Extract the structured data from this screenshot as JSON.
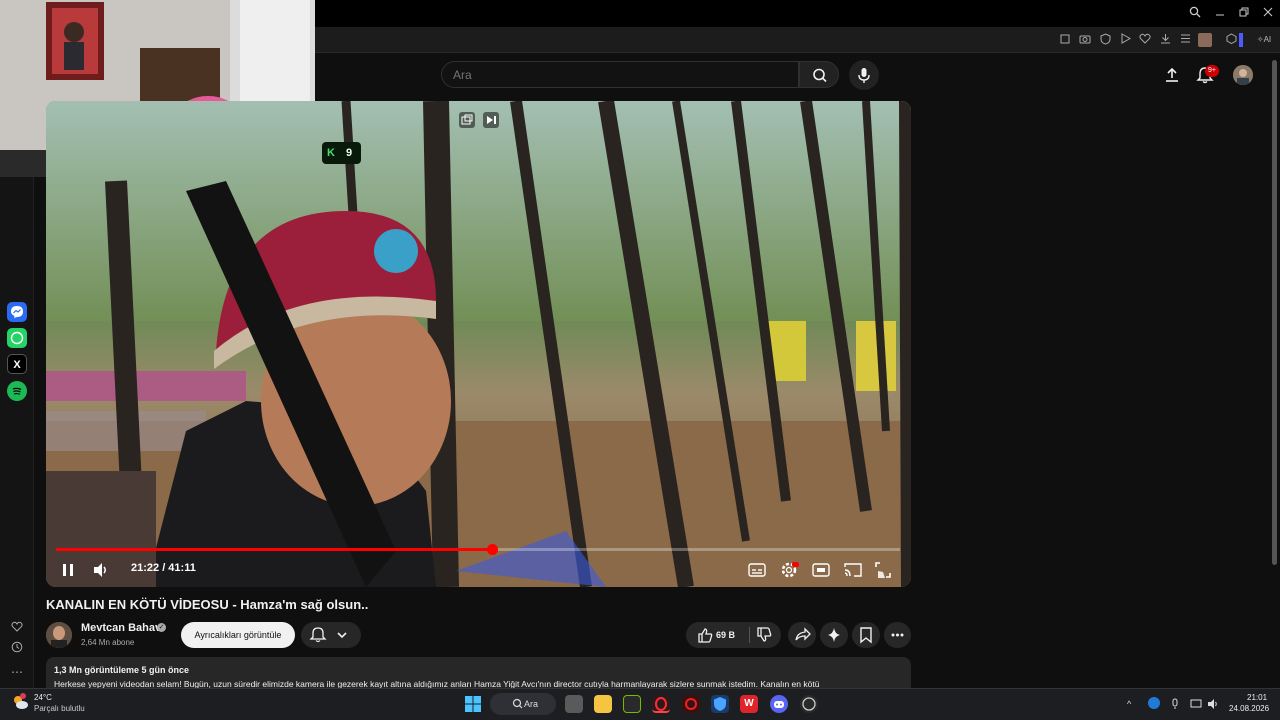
{
  "search": {
    "placeholder": "Ara"
  },
  "header": {
    "notif_badge": "9+"
  },
  "overlay": {
    "counter": "9"
  },
  "player": {
    "time": "21:22 / 41:11",
    "progress": 0.5171
  },
  "video": {
    "title": "KANALIN EN KÖTÜ VİDEOSU - Hamza'm sağ olsun.."
  },
  "channel": {
    "name": "Mevtcan Bahav",
    "subscribers": "2,64 Mn abone",
    "join_label": "Ayrıcalıkları görüntüle"
  },
  "actions": {
    "likes": "69 B"
  },
  "description": {
    "meta": "1,3 Mn görüntüleme  5 gün önce",
    "text": "Herkese yepyeni videodan selam! Bugün, uzun süredir elimizde kamera ile gezerek kayıt altına aldığımız anları Hamza Yiğit Avcı'nın director cutıyla harmanlayarak sizlere sunmak istedim. Kanalın en kötü"
  },
  "taskbar": {
    "weather_temp": "24°C",
    "weather_desc": "Parçalı bulutlu",
    "search_label": "Ara",
    "time": "21:01",
    "date": "24.08.2026"
  },
  "colors": {
    "accent": "#ff0000",
    "bg": "#0f0f0f"
  }
}
